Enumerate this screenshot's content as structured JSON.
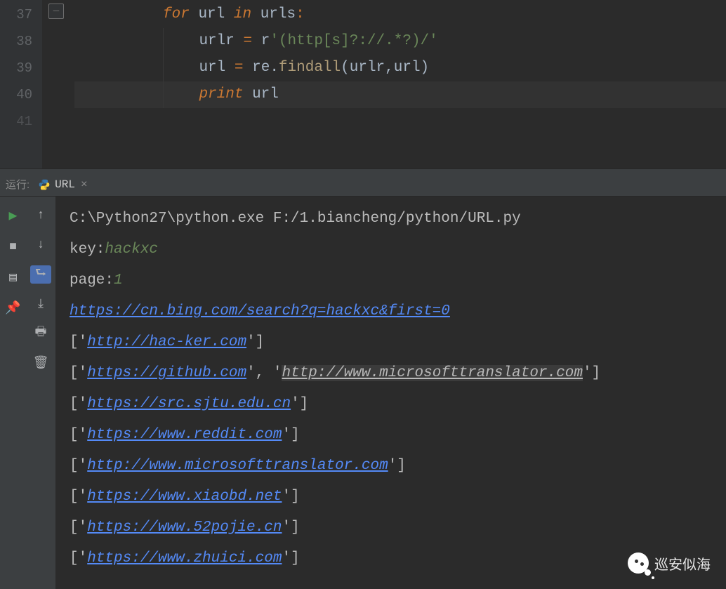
{
  "gutter": {
    "l1": "37",
    "l2": "38",
    "l3": "39",
    "l4": "40",
    "l5": "41"
  },
  "code": {
    "l1": {
      "kw_for": "for",
      "v1": "url",
      "kw_in": "in",
      "v2": "urls",
      "colon": ":"
    },
    "l2": {
      "v": "urlr",
      "eq": "=",
      "r": "r",
      "str": "'(http[s]?://.*?)/'"
    },
    "l3": {
      "v": "url",
      "eq": "=",
      "mod": "re",
      "dot": ".",
      "fn": "findall",
      "args": "(urlr,url)"
    },
    "l4": {
      "kw": "print",
      "v": "url"
    }
  },
  "run": {
    "label": "运行:",
    "tab": "URL",
    "close": "×"
  },
  "console": {
    "cmd": "C:\\Python27\\python.exe F:/1.biancheng/python/URL.py",
    "key_lbl": "key:",
    "key_val": "hackxc",
    "page_lbl": "page:",
    "page_val": "1",
    "u0": "https://cn.bing.com/search?q=hackxc&first=0",
    "rows": [
      {
        "a": "http://hac-ker.com"
      },
      {
        "a": "https://github.com",
        "b": "http://www.microsofttranslator.com"
      },
      {
        "a": "https://src.sjtu.edu.cn"
      },
      {
        "a": "https://www.reddit.com"
      },
      {
        "a": "http://www.microsofttranslator.com"
      },
      {
        "a": "https://www.xiaobd.net"
      },
      {
        "a": "https://www.52pojie.cn"
      },
      {
        "a": "https://www.zhuici.com"
      }
    ]
  },
  "watermark": "巡安似海"
}
